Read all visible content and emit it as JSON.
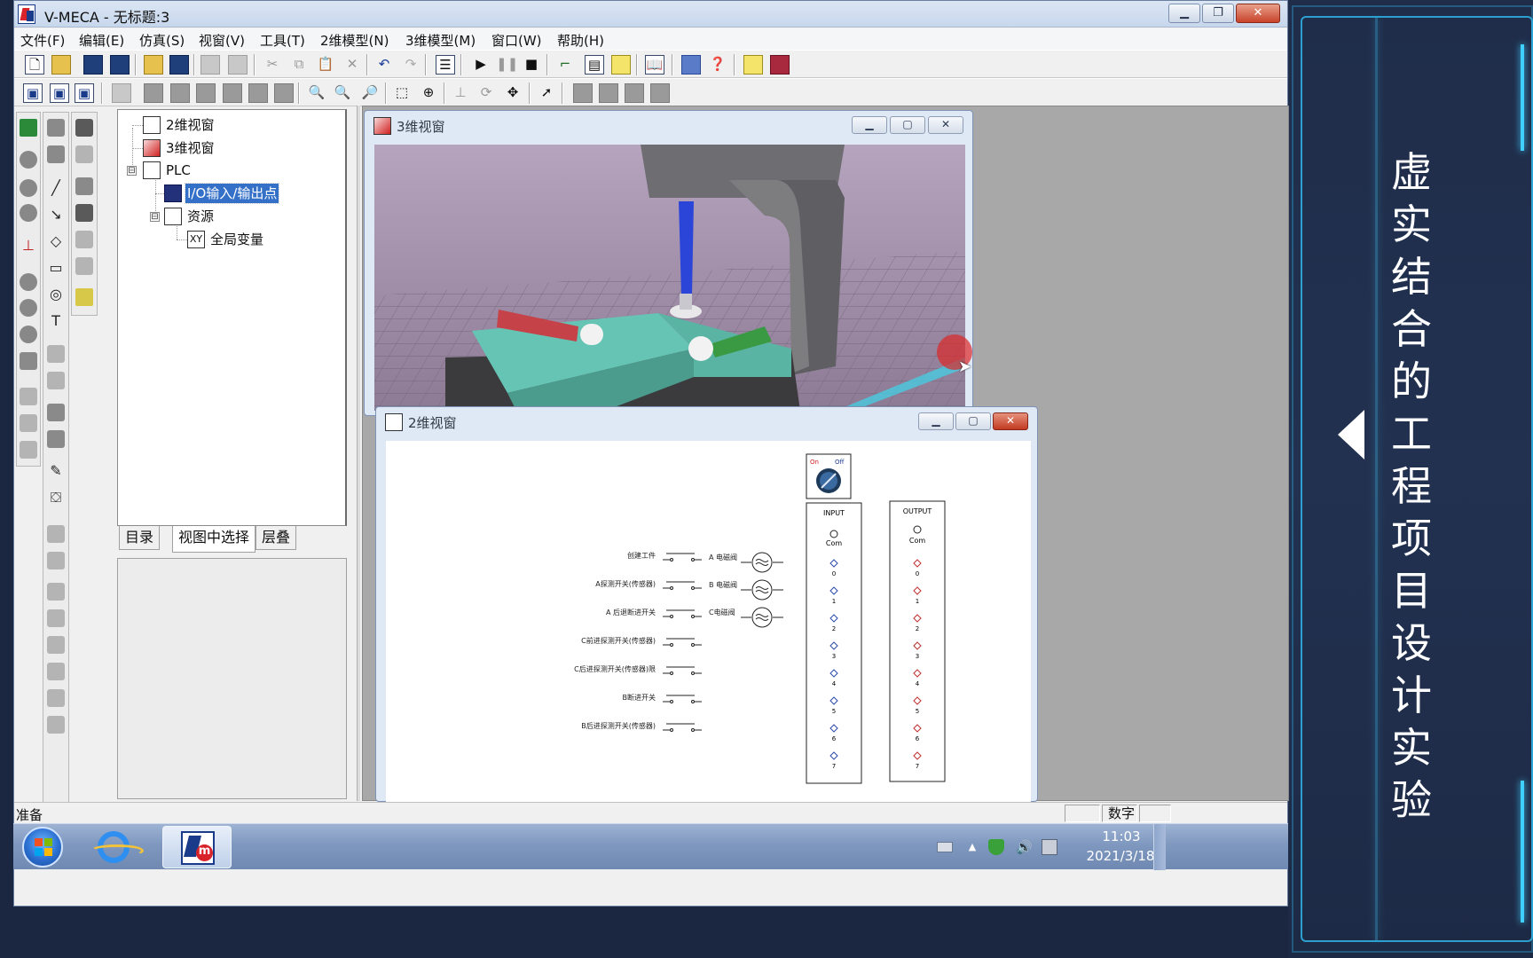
{
  "app": {
    "title": "V-MECA - 无标题:3"
  },
  "menu": [
    "文件(F)",
    "编辑(E)",
    "仿真(S)",
    "视窗(V)",
    "工具(T)",
    "2维模型(N)",
    "3维模型(M)",
    "窗口(W)",
    "帮助(H)"
  ],
  "tree": {
    "items": [
      "2维视窗",
      "3维视窗",
      "PLC",
      "I/O输入/输出点",
      "资源",
      "全局变量"
    ],
    "xy_icon": "XY",
    "expand_symbol": "⊟"
  },
  "tabs": [
    "目录",
    "视图中选择",
    "层叠"
  ],
  "window3d": {
    "title": "3维视窗"
  },
  "window2d": {
    "title": "2维视窗",
    "switch_on": "On",
    "switch_off": "Off",
    "input_header": "INPUT",
    "output_header": "OUTPUT",
    "com_label": "Com",
    "terminal_numbers": [
      "0",
      "1",
      "2",
      "3",
      "4",
      "5",
      "6",
      "7"
    ],
    "switches": [
      "创建工件",
      "A探测开关(传感器)",
      "A 后退断进开关",
      "C前进探测开关(传感器)",
      "C后进探测开关(传感器)限",
      "B断进开关",
      "B后进探测开关(传感器)"
    ],
    "valves": [
      "A 电磁阀",
      "B 电磁阀",
      "C电磁阀"
    ]
  },
  "status": {
    "text": "准备",
    "mode": "数字"
  },
  "taskbar": {
    "time": "11:03",
    "date": "2021/3/18"
  },
  "side_title": [
    "虚",
    "实",
    "结",
    "合",
    "的",
    "工",
    "程",
    "项",
    "目",
    "设",
    "计",
    "实",
    "验"
  ],
  "icons": [
    "app-logo-icon",
    "minimize-icon",
    "restore-icon",
    "close-icon",
    "new-file-icon",
    "open-folder-icon",
    "save-icon",
    "play-icon",
    "pause-icon",
    "stop-icon",
    "undo-icon",
    "redo-icon",
    "zoom-in-icon",
    "zoom-out-icon",
    "pan-icon",
    "pointer-icon",
    "start-orb-icon",
    "ie-icon",
    "vmeca-taskbar-icon",
    "volume-icon",
    "network-icon",
    "shield-icon"
  ],
  "colors": {
    "accent_cyan": "#2fb4e8",
    "selection_blue": "#3470c8",
    "taskbar_blue": "#7f98bf",
    "close_red": "#c8432a"
  }
}
